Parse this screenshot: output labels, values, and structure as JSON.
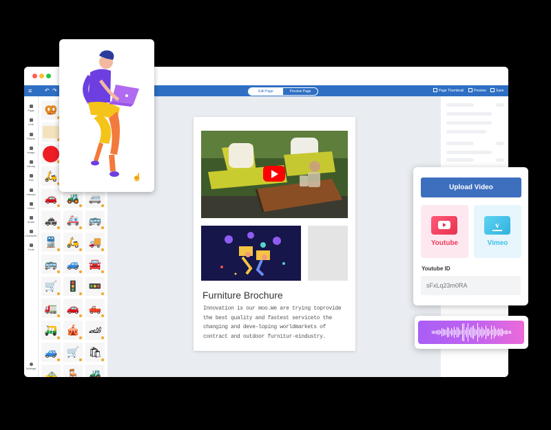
{
  "toolbar": {
    "edit_page": "Edit Page",
    "preview_page": "Preview Page",
    "page_thumbnail": "Page Thumbnail",
    "preview": "Preview",
    "save": "Save"
  },
  "nav": {
    "items": [
      "Page",
      "Link",
      "Phone",
      "Image",
      "Library",
      "Text",
      "Interact",
      "Video",
      "Audio",
      "Character",
      "Tools"
    ],
    "settings": "Settings"
  },
  "page": {
    "title": "Furniture Brochure",
    "body": "Innovation is our moo.We are trying toprovide the best quality and fastest serviceto the changing and deve-loping worldmarkets of contract and outdoor furnitur-eindustry."
  },
  "upload": {
    "button": "Upload Video",
    "youtube": "Youtube",
    "vimeo": "Vimeo",
    "id_label": "Youtube ID",
    "id_placeholder": "sFxLq23m0RA"
  },
  "colors": {
    "toolbar": "#2e6fc4",
    "accent": "#3d6fbf",
    "youtube": "#ef3b5d",
    "vimeo": "#3cc1e8"
  }
}
